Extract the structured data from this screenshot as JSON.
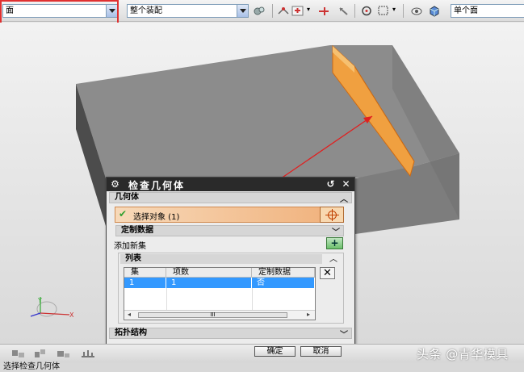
{
  "toolbar": {
    "type_filter": "面",
    "scope_filter": "整个装配",
    "selection_intent": "单个面"
  },
  "dialog": {
    "title": "检查几何体",
    "geometry_section": "几何体",
    "select_object": "选择对象 (1)",
    "custom_data": "定制数据",
    "add_new_set": "添加新集",
    "list_section": "列表",
    "columns": [
      "集",
      "项数",
      "定制数据"
    ],
    "rows": [
      [
        "1",
        "1",
        "否"
      ]
    ],
    "scroll_mid": "III",
    "topology_section": "拓扑结构",
    "ok": "确定",
    "cancel": "取消"
  },
  "status_text": "选择检查几何体",
  "watermark": "头条 @青华模具",
  "colors": {
    "selected_face": "#f0a040",
    "block": "#8a8a8a",
    "annotation": "#e02020",
    "row_highlight": "#3399ff"
  }
}
